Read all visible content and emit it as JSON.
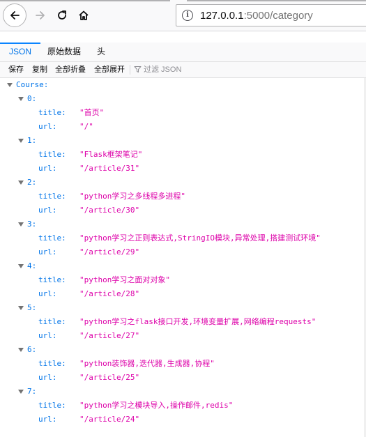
{
  "browser": {
    "url_host": "127.0.0.1",
    "url_path": ":5000/category"
  },
  "viewer": {
    "tabs": [
      {
        "label": "JSON",
        "selected": true
      },
      {
        "label": "原始数据",
        "selected": false
      },
      {
        "label": "头",
        "selected": false
      }
    ],
    "actions": {
      "save": "保存",
      "copy": "复制",
      "collapse_all": "全部折叠",
      "expand_all": "全部展开",
      "filter_placeholder": "过滤 JSON"
    }
  },
  "tree": {
    "root_key": "Course:",
    "items": [
      {
        "index": "0:",
        "title": "\"首页\"",
        "url": "\"/\""
      },
      {
        "index": "1:",
        "title": "\"Flask框架笔记\"",
        "url": "\"/article/31\""
      },
      {
        "index": "2:",
        "title": "\"python学习之多线程多进程\"",
        "url": "\"/article/30\""
      },
      {
        "index": "3:",
        "title": "\"python学习之正则表达式,StringIO模块,异常处理,搭建测试环境\"",
        "url": "\"/article/29\""
      },
      {
        "index": "4:",
        "title": "\"python学习之面对对象\"",
        "url": "\"/article/28\""
      },
      {
        "index": "5:",
        "title": "\"python学习之flask接口开发,环境变量扩展,网络编程requests\"",
        "url": "\"/article/27\""
      },
      {
        "index": "6:",
        "title": "\"python装饰器,迭代器,生成器,协程\"",
        "url": "\"/article/25\""
      },
      {
        "index": "7:",
        "title": "\"python学习之模块导入,操作邮件,redis\"",
        "url": "\"/article/24\""
      }
    ],
    "title_key": "title:",
    "url_key": "url:"
  },
  "colors": {
    "key": "#0074e8",
    "string": "#dd00a9",
    "tab_selected": "#0a84ff"
  }
}
